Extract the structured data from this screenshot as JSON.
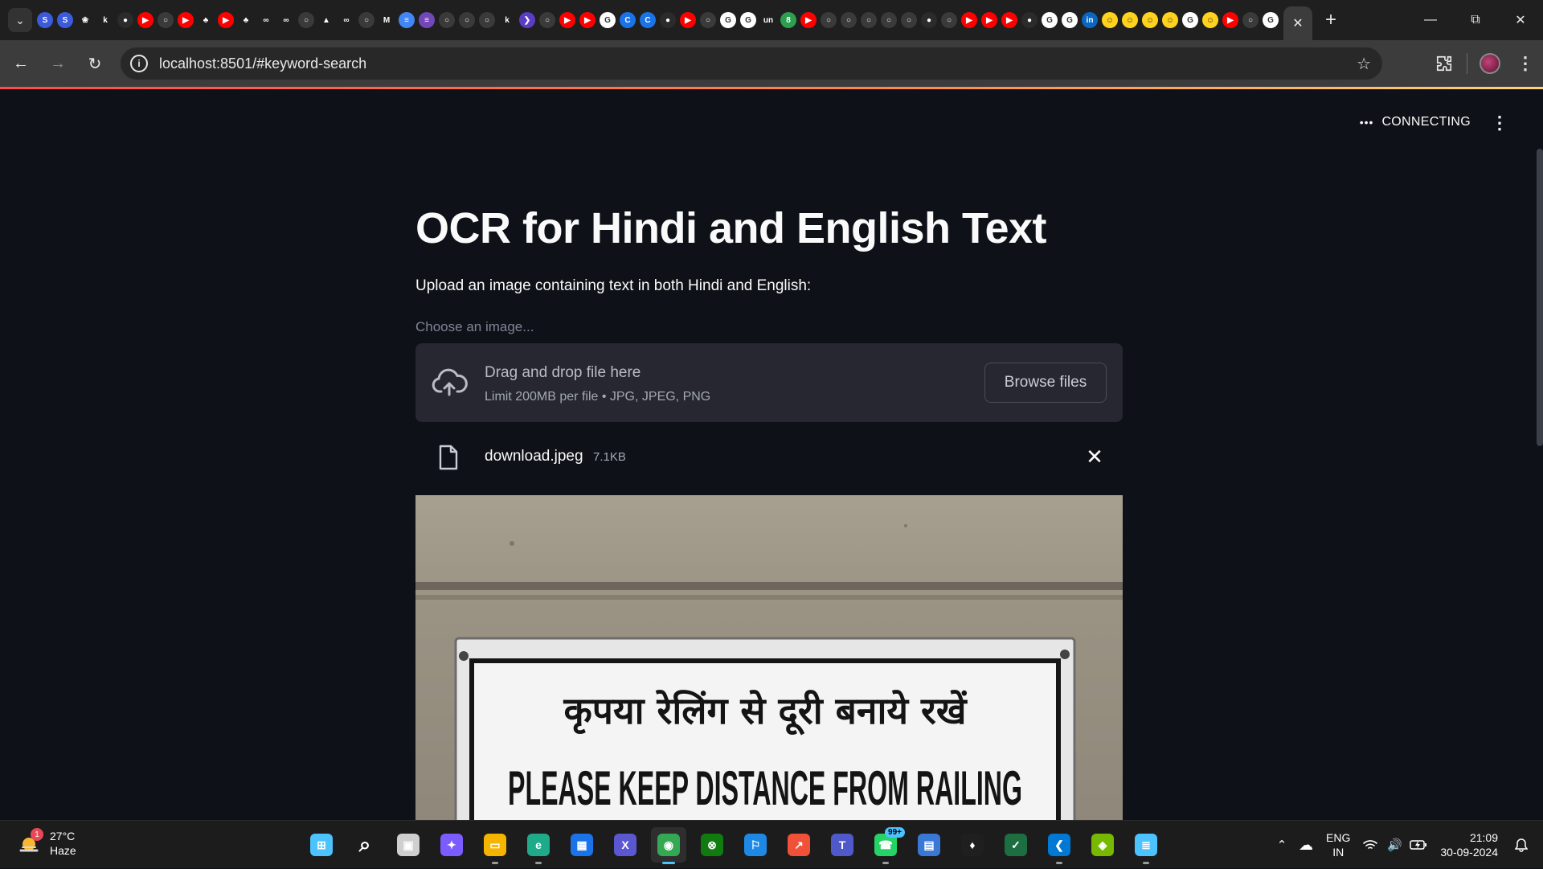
{
  "browser": {
    "pinned_tab_icons": [
      "shield-icon",
      "shield-icon",
      "openai-icon",
      "k-icon",
      "github-icon",
      "youtube-icon",
      "clock-icon",
      "youtube-icon",
      "leaf-icon",
      "youtube-icon",
      "leaf-icon",
      "link-icon",
      "link-icon",
      "gem-icon",
      "drive-icon",
      "link-icon",
      "medium-icon",
      "gmail-icon",
      "docs-icon",
      "forms-icon",
      "target-icon",
      "circle-icon",
      "h-icon",
      "k-icon",
      "terminal-icon",
      "infinity-icon",
      "youtube-icon",
      "youtube-icon",
      "google-icon",
      "c-icon",
      "c-icon",
      "github-icon",
      "youtube-icon",
      "puzzle-icon",
      "google-icon",
      "google-icon",
      "un-icon",
      "number-icon",
      "youtube-icon",
      "kite-icon",
      "bars-icon",
      "dot-icon",
      "cloud-icon",
      "plus-circle-icon",
      "github-icon",
      "globe-icon",
      "youtube-icon",
      "youtube-icon",
      "youtube-icon",
      "github-icon",
      "google-icon",
      "google-icon",
      "linkedin-icon",
      "hugging-icon",
      "hugging-icon",
      "hugging-icon",
      "hugging-icon",
      "google-icon",
      "hugging-icon",
      "youtube-icon",
      "crown-icon",
      "google-icon"
    ],
    "url": "localhost:8501/#keyword-search"
  },
  "app": {
    "status": "CONNECTING",
    "title": "OCR for Hindi and English Text",
    "subtitle": "Upload an image containing text in both Hindi and English:",
    "uploader": {
      "label": "Choose an image...",
      "drop_text": "Drag and drop file here",
      "limit_text": "Limit 200MB per file • JPG, JPEG, PNG",
      "browse_label": "Browse files"
    },
    "file": {
      "name": "download.jpeg",
      "size": "7.1KB"
    },
    "image": {
      "hindi_line": "कृपया रेलिंग से दूरी बनाये रखें",
      "english_line": "PLEASE KEEP DISTANCE FROM RAILING"
    }
  },
  "taskbar": {
    "weather": {
      "badge": "1",
      "temp": "27°C",
      "condition": "Haze"
    },
    "apps": [
      "windows-start",
      "search",
      "task-view",
      "copilot",
      "file-explorer",
      "edge",
      "microsoft-store",
      "xampp",
      "chrome",
      "xbox",
      "safari-like",
      "swift",
      "teams",
      "whatsapp",
      "phone-link",
      "mongodb",
      "excel-like",
      "vscode",
      "nvidia",
      "notepad"
    ],
    "whatsapp_badge": "99+",
    "language": {
      "line1": "ENG",
      "line2": "IN"
    },
    "clock": {
      "time": "21:09",
      "date": "30-09-2024"
    }
  }
}
